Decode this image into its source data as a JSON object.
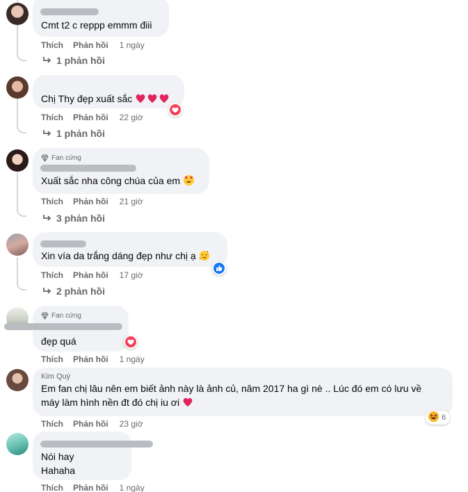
{
  "actions": {
    "like": "Thích",
    "reply": "Phản hồi"
  },
  "comments": [
    {
      "text": "Cmt t2 c reppp emmm điii",
      "time": "1 ngày",
      "replies": "1 phản hồi"
    },
    {
      "text": "Chị Thy đẹp xuất sắc",
      "time": "22 giờ",
      "replies": "1 phản hồi"
    },
    {
      "badge": "Fan cứng",
      "text": "Xuất sắc nha công chúa của em",
      "time": "21 giờ",
      "replies": "3 phản hồi"
    },
    {
      "text": "Xin vía da trắng dáng đẹp như chị ạ",
      "time": "17 giờ",
      "replies": "2 phản hồi"
    },
    {
      "badge": "Fan cứng",
      "text": "đẹp quá",
      "time": "1 ngày"
    },
    {
      "author": "Kim Quý",
      "line1": "Em fan chị lâu nên em biết ảnh này là ảnh củ, năm 2017 ha gì nè .. Lúc đó em có lưu về",
      "line2": "máy làm hình nền đt đó chị iu ơi",
      "time": "23 giờ",
      "reaction_count": "6"
    },
    {
      "line1": "Nói hay",
      "line2": "Hahaha",
      "time": "1 ngày"
    }
  ],
  "colors": {
    "bubble": "#f0f2f5",
    "meta": "#65676b",
    "heart": "#f33e58",
    "like": "#1877f2",
    "redacted": "#b9bcc1"
  }
}
